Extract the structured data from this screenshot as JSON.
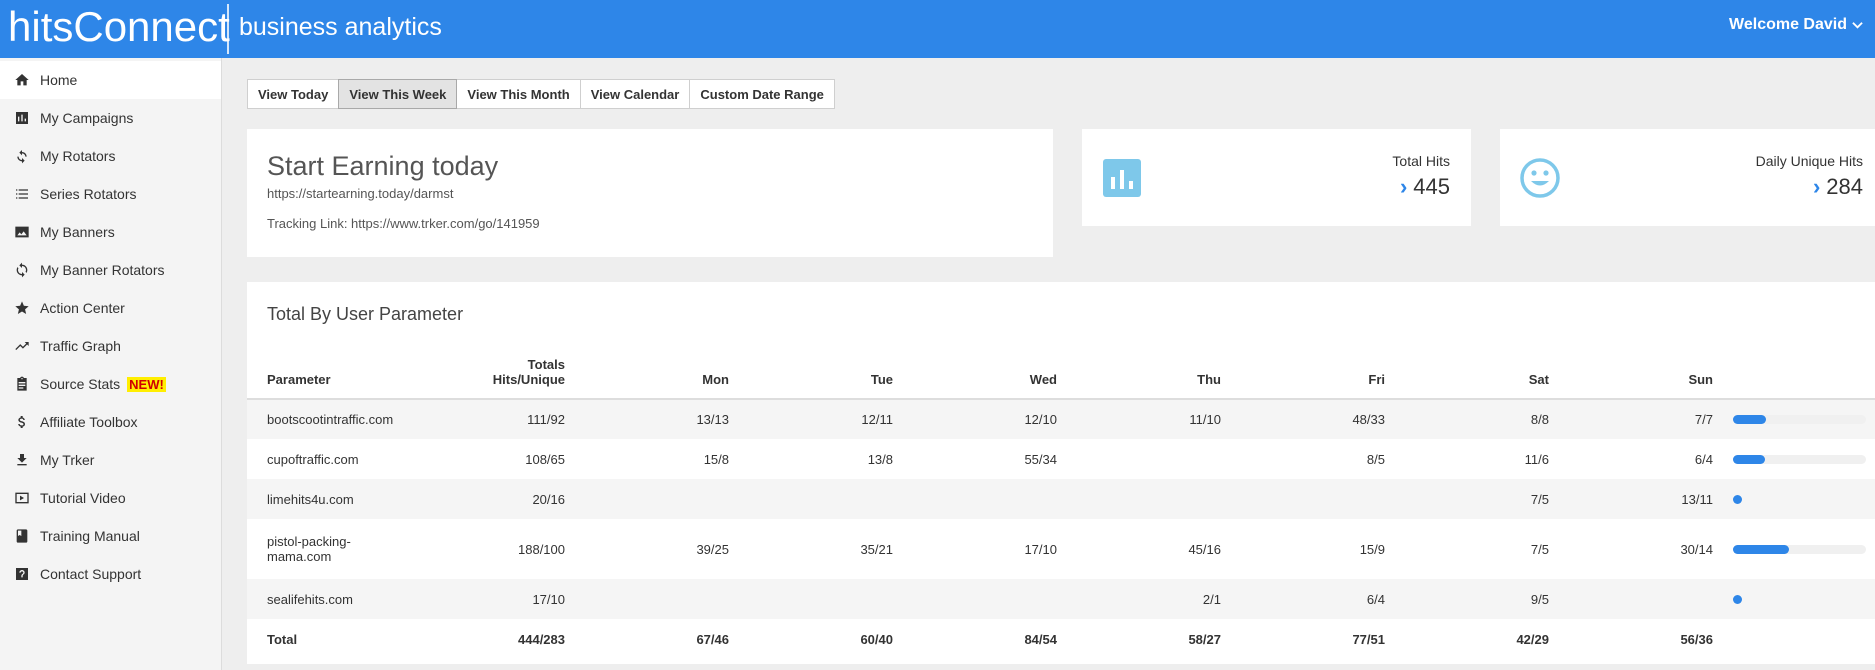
{
  "header": {
    "brand": "hitsConnect",
    "subtitle": "business analytics",
    "welcome": "Welcome David"
  },
  "sidebar": {
    "items": [
      {
        "label": "Home",
        "icon": "home-icon"
      },
      {
        "label": "My Campaigns",
        "icon": "bar-chart-icon"
      },
      {
        "label": "My Rotators",
        "icon": "rotate-icon"
      },
      {
        "label": "Series Rotators",
        "icon": "list-icon"
      },
      {
        "label": "My Banners",
        "icon": "image-icon"
      },
      {
        "label": "My Banner Rotators",
        "icon": "refresh-icon"
      },
      {
        "label": "Action Center",
        "icon": "star-icon"
      },
      {
        "label": "Traffic Graph",
        "icon": "trending-icon"
      },
      {
        "label": "Source Stats",
        "icon": "clipboard-icon",
        "badge": "NEW!"
      },
      {
        "label": "Affiliate Toolbox",
        "icon": "dollar-icon"
      },
      {
        "label": "My Trker",
        "icon": "download-icon"
      },
      {
        "label": "Tutorial Video",
        "icon": "video-icon"
      },
      {
        "label": "Training Manual",
        "icon": "book-icon"
      },
      {
        "label": "Contact Support",
        "icon": "help-icon"
      }
    ]
  },
  "range_buttons": [
    "View Today",
    "View This Week",
    "View This Month",
    "View Calendar",
    "Custom Date Range"
  ],
  "active_range": "View This Week",
  "campaign": {
    "title": "Start Earning today",
    "url": "https://startearning.today/darmst",
    "tracking": "Tracking Link: https://www.trker.com/go/141959"
  },
  "stats": {
    "total_hits_label": "Total Hits",
    "total_hits_value": "445",
    "unique_label": "Daily Unique Hits",
    "unique_value": "284"
  },
  "table": {
    "title": "Total By User Parameter",
    "headers": {
      "parameter": "Parameter",
      "totals_line1": "Totals",
      "totals_line2": "Hits/Unique",
      "days": [
        "Mon",
        "Tue",
        "Wed",
        "Thu",
        "Fri",
        "Sat",
        "Sun"
      ]
    },
    "rows": [
      {
        "parameter": "bootscootintraffic.com",
        "total": "111/92",
        "days": [
          "13/13",
          "12/11",
          "12/10",
          "11/10",
          "48/33",
          "8/8",
          "7/7"
        ],
        "share": 0.25
      },
      {
        "parameter": "cupoftraffic.com",
        "total": "108/65",
        "days": [
          "15/8",
          "13/8",
          "55/34",
          "",
          "8/5",
          "11/6",
          "6/4"
        ],
        "share": 0.24
      },
      {
        "parameter": "limehits4u.com",
        "total": "20/16",
        "days": [
          "",
          "",
          "",
          "",
          "",
          "7/5",
          "13/11"
        ],
        "share": 0.045
      },
      {
        "parameter": "pistol-packing-mama.com",
        "parameter_line1": "pistol-packing-",
        "parameter_line2": "mama.com",
        "total": "188/100",
        "days": [
          "39/25",
          "35/21",
          "17/10",
          "45/16",
          "15/9",
          "7/5",
          "30/14"
        ],
        "share": 0.42
      },
      {
        "parameter": "sealifehits.com",
        "total": "17/10",
        "days": [
          "",
          "",
          "",
          "2/1",
          "6/4",
          "9/5",
          ""
        ],
        "share": 0.04
      }
    ],
    "total_row": {
      "label": "Total",
      "total": "444/283",
      "days": [
        "67/46",
        "60/40",
        "84/54",
        "58/27",
        "77/51",
        "42/29",
        "56/36"
      ]
    }
  },
  "colors": {
    "brand_blue": "#2e86e8",
    "icon_light_blue": "#7ec8ea",
    "badge_bg": "#ffee00",
    "badge_text": "#d00000"
  }
}
